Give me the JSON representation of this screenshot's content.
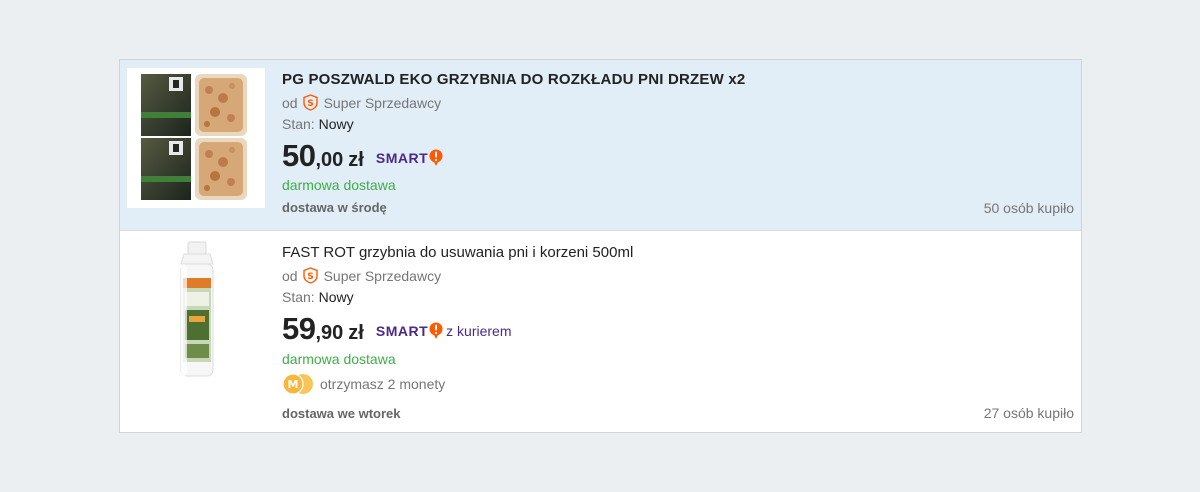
{
  "listings": [
    {
      "title": "PG POSZWALD EKO GRZYBNIA DO ROZKŁADU PNI DRZEW x2",
      "seller_prefix": "od",
      "seller_name": "Super Sprzedawcy",
      "condition_label": "Stan:",
      "condition_value": "Nowy",
      "price_int": "50",
      "price_dec": ",00",
      "currency": "zł",
      "smart_label": "SMART",
      "smart_extra": "",
      "shipping": "darmowa dostawa",
      "delivery": "dostawa w środę",
      "bought": "50 osób kupiło",
      "image": "mycelium-packages-image"
    },
    {
      "title": "FAST ROT grzybnia do usuwania pni i korzeni 500ml",
      "seller_prefix": "od",
      "seller_name": "Super Sprzedawcy",
      "condition_label": "Stan:",
      "condition_value": "Nowy",
      "price_int": "59",
      "price_dec": ",90",
      "currency": "zł",
      "smart_label": "SMART",
      "smart_extra": "z kurierem",
      "shipping": "darmowa dostawa",
      "coins": "otrzymasz 2 monety",
      "delivery": "dostawa we wtorek",
      "bought": "27 osób kupiło",
      "image": "bottle-image"
    }
  ],
  "colors": {
    "page_bg": "#eceff2",
    "highlight_bg": "#e1edf7",
    "shipping_green": "#3fae49",
    "smart_purple": "#4b2986",
    "smart_orange": "#ff5a00",
    "coin_gold": "#f6b73c"
  }
}
